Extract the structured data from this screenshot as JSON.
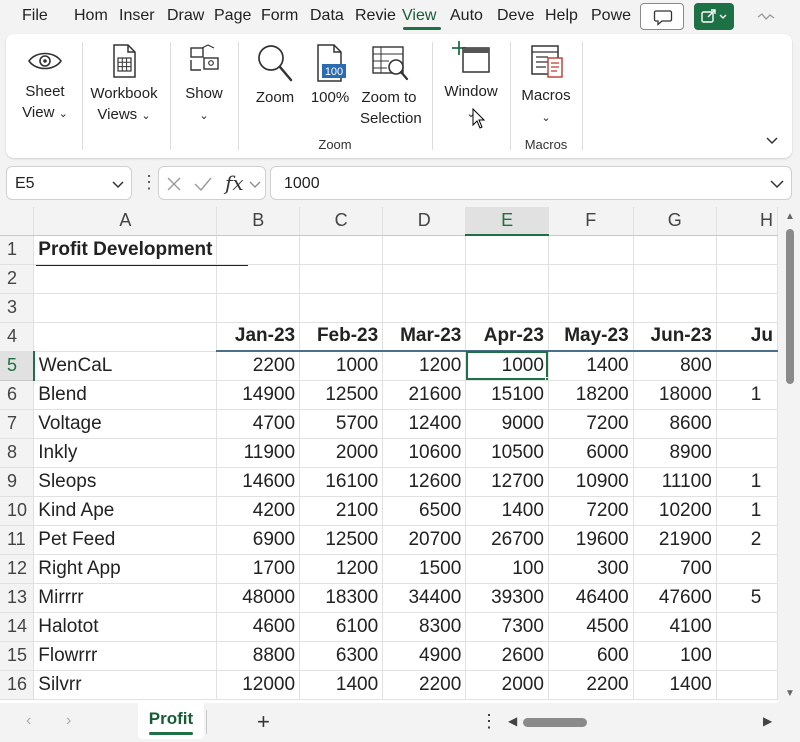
{
  "menu": {
    "tabs": [
      "File",
      "Hom",
      "Inser",
      "Draw",
      "Page",
      "Form",
      "Data",
      "Revie",
      "View",
      "Auto",
      "Deve",
      "Help",
      "Powe"
    ],
    "active": "View"
  },
  "ribbon": {
    "sheet_view": "Sheet View",
    "sheet_view_l1": "Sheet",
    "sheet_view_l2": "View",
    "workbook_views_l1": "Workbook",
    "workbook_views_l2": "Views",
    "show": "Show",
    "zoom": "Zoom",
    "zoom_100": "100%",
    "zoom_100_icon_text": "100",
    "zoom_to_selection_l1": "Zoom to",
    "zoom_to_selection_l2": "Selection",
    "zoom_group": "Zoom",
    "window": "Window",
    "macros": "Macros",
    "macros_group": "Macros"
  },
  "formula_bar": {
    "name_box": "E5",
    "fx": "fx",
    "value": "1000"
  },
  "sheet": {
    "columns": [
      "A",
      "B",
      "C",
      "D",
      "E",
      "F",
      "G",
      "H"
    ],
    "selected_column": "E",
    "selected_row": 5,
    "title": "Profit Development",
    "months": [
      "Jan-23",
      "Feb-23",
      "Mar-23",
      "Apr-23",
      "May-23",
      "Jun-23",
      "Ju"
    ],
    "rows": [
      {
        "name": "WenCaL",
        "values": [
          "2200",
          "1000",
          "1200",
          "1000",
          "1400",
          "800",
          ""
        ]
      },
      {
        "name": "Blend",
        "values": [
          "14900",
          "12500",
          "21600",
          "15100",
          "18200",
          "18000",
          "1"
        ]
      },
      {
        "name": "Voltage",
        "values": [
          "4700",
          "5700",
          "12400",
          "9000",
          "7200",
          "8600",
          ""
        ]
      },
      {
        "name": "Inkly",
        "values": [
          "11900",
          "2000",
          "10600",
          "10500",
          "6000",
          "8900",
          ""
        ]
      },
      {
        "name": "Sleops",
        "values": [
          "14600",
          "16100",
          "12600",
          "12700",
          "10900",
          "11100",
          "1"
        ]
      },
      {
        "name": "Kind Ape",
        "values": [
          "4200",
          "2100",
          "6500",
          "1400",
          "7200",
          "10200",
          "1"
        ]
      },
      {
        "name": "Pet Feed",
        "values": [
          "6900",
          "12500",
          "20700",
          "26700",
          "19600",
          "21900",
          "2"
        ]
      },
      {
        "name": "Right App",
        "values": [
          "1700",
          "1200",
          "1500",
          "100",
          "300",
          "700",
          ""
        ]
      },
      {
        "name": "Mirrrr",
        "values": [
          "48000",
          "18300",
          "34400",
          "39300",
          "46400",
          "47600",
          "5"
        ]
      },
      {
        "name": "Halotot",
        "values": [
          "4600",
          "6100",
          "8300",
          "7300",
          "4500",
          "4100",
          ""
        ]
      },
      {
        "name": "Flowrrr",
        "values": [
          "8800",
          "6300",
          "4900",
          "2600",
          "600",
          "100",
          ""
        ]
      },
      {
        "name": "Silvrr",
        "values": [
          "12000",
          "1400",
          "2200",
          "2000",
          "2200",
          "1400",
          ""
        ]
      }
    ]
  },
  "sheet_tabs": {
    "active": "Profit",
    "add": "+"
  },
  "colors": {
    "accent": "#1e7145",
    "header_border": "#4a6f8a"
  },
  "icons": [
    "eye-icon",
    "workbook-icon",
    "show-icon",
    "magnifier-icon",
    "zoom-100-icon",
    "zoom-selection-icon",
    "window-icon",
    "macros-icon",
    "comment-icon",
    "share-icon",
    "cancel-icon",
    "enter-icon",
    "chevron-down-icon"
  ]
}
